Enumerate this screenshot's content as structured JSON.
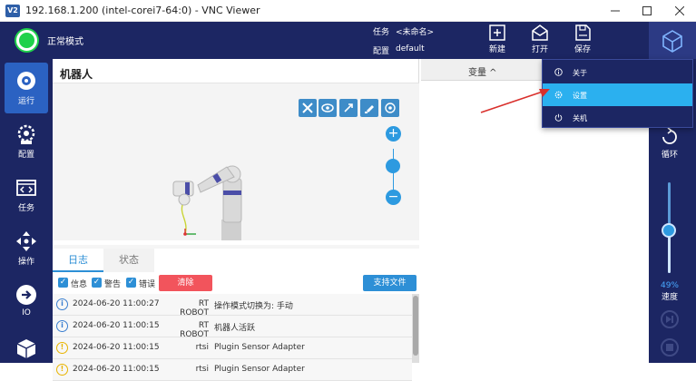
{
  "window": {
    "icon_text": "V2",
    "title": "192.168.1.200 (intel-corei7-64:0) - VNC Viewer"
  },
  "header": {
    "mode": "正常模式",
    "task_label": "任务",
    "task_value": "<未命名>",
    "config_label": "配置",
    "config_value": "default",
    "buttons": [
      {
        "label": "新建",
        "icon": "new-file-icon"
      },
      {
        "label": "打开",
        "icon": "open-mail-icon"
      },
      {
        "label": "保存",
        "icon": "save-file-icon"
      }
    ],
    "logo_icon": "cube-logo-icon"
  },
  "nav": [
    {
      "label": "运行",
      "icon": "run-target-icon",
      "active": true
    },
    {
      "label": "配置",
      "icon": "robot-gear-icon",
      "active": false
    },
    {
      "label": "任务",
      "icon": "code-window-icon",
      "active": false
    },
    {
      "label": "操作",
      "icon": "move-arrows-icon",
      "active": false
    },
    {
      "label": "IO",
      "icon": "io-circle-icon",
      "active": false
    },
    {
      "label": "",
      "icon": "box-icon",
      "active": false
    }
  ],
  "robot_panel": {
    "title": "机器人",
    "tools": [
      "tools-icon",
      "eye-icon",
      "rotate-icon",
      "brush-icon",
      "target-icon"
    ],
    "zoom_in": "+",
    "zoom_out": "−"
  },
  "log": {
    "tabs": [
      "日志",
      "状态"
    ],
    "filters": [
      {
        "label": "信息",
        "checked": true
      },
      {
        "label": "警告",
        "checked": true
      },
      {
        "label": "错误",
        "checked": true
      }
    ],
    "clear_label": "清除",
    "support_label": "支持文件",
    "rows": [
      {
        "level": "info",
        "time": "2024-06-20 11:00:27",
        "source": "RT ROBOT",
        "message": "操作模式切换为: 手动"
      },
      {
        "level": "info",
        "time": "2024-06-20 11:00:15",
        "source": "RT ROBOT",
        "message": "机器人活跃"
      },
      {
        "level": "warn",
        "time": "2024-06-20 11:00:15",
        "source": "rtsi",
        "message": "Plugin Sensor Adapter"
      },
      {
        "level": "warn",
        "time": "2024-06-20 11:00:15",
        "source": "rtsi",
        "message": "Plugin Sensor Adapter"
      }
    ]
  },
  "variables": {
    "title": "变量 ^"
  },
  "right_rail": {
    "loop_label": "循环",
    "speed_value": "49%",
    "speed_label": "速度",
    "speed_fraction": 0.49
  },
  "menu": {
    "items": [
      {
        "label": "关于",
        "icon": "info-icon",
        "highlighted": false
      },
      {
        "label": "设置",
        "icon": "settings-icon",
        "highlighted": true
      },
      {
        "label": "关机",
        "icon": "power-icon",
        "highlighted": false
      }
    ]
  },
  "colors": {
    "navy": "#1c2663",
    "accent_blue": "#2d8fd6",
    "highlight": "#2bb0ef",
    "status_green": "#1fd14b",
    "danger_red": "#f2545c",
    "arrow_red": "#d9302c"
  }
}
